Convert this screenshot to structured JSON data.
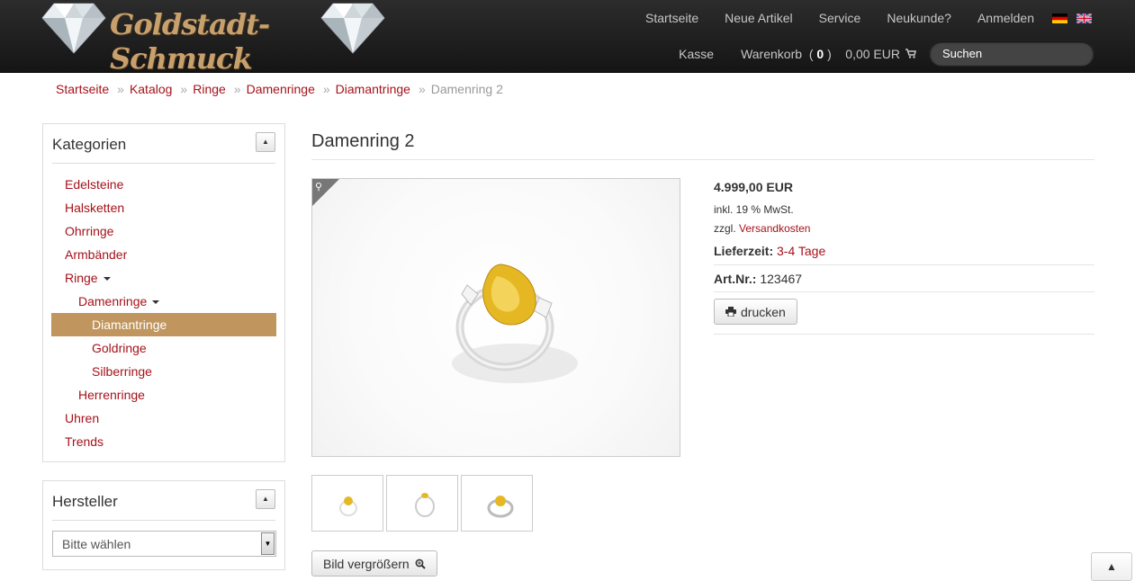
{
  "header": {
    "logo_text": "Goldstadt-Schmuck",
    "nav_top": [
      "Startseite",
      "Neue Artikel",
      "Service",
      "Neukunde?",
      "Anmelden"
    ],
    "nav_checkout": "Kasse",
    "cart_label": "Warenkorb",
    "cart_open": "(",
    "cart_count": "0",
    "cart_close": ")",
    "cart_total": "0,00 EUR",
    "search_placeholder": "Suchen"
  },
  "breadcrumb": [
    "Startseite",
    "Katalog",
    "Ringe",
    "Damenringe",
    "Diamantringe"
  ],
  "breadcrumb_current": "Damenring 2",
  "breadcrumb_sep": "»",
  "categories": {
    "title": "Kategorien",
    "items": [
      {
        "label": "Edelsteine"
      },
      {
        "label": "Halsketten"
      },
      {
        "label": "Ohrringe"
      },
      {
        "label": "Armbänder"
      },
      {
        "label": "Ringe"
      },
      {
        "label": "Damenringe"
      },
      {
        "label": "Diamantringe"
      },
      {
        "label": "Goldringe"
      },
      {
        "label": "Silberringe"
      },
      {
        "label": "Herrenringe"
      },
      {
        "label": "Uhren"
      },
      {
        "label": "Trends"
      }
    ]
  },
  "manufacturer": {
    "title": "Hersteller",
    "select_value": "Bitte wählen"
  },
  "product": {
    "title": "Damenring 2",
    "price": "4.999,00 EUR",
    "tax_note": "inkl. 19 % MwSt.",
    "shipping_prefix": "zzgl.",
    "shipping_link": "Versandkosten",
    "delivery_label": "Lieferzeit:",
    "delivery_value": "3-4 Tage",
    "sku_label": "Art.Nr.:",
    "sku_value": "123467",
    "print_label": "drucken",
    "enlarge_label": "Bild vergrößern"
  },
  "colors": {
    "accent": "#a5121b",
    "active_category": "#c0955e",
    "header_bg": "#1c1c1c",
    "logo_gold": "#c8a06c"
  }
}
